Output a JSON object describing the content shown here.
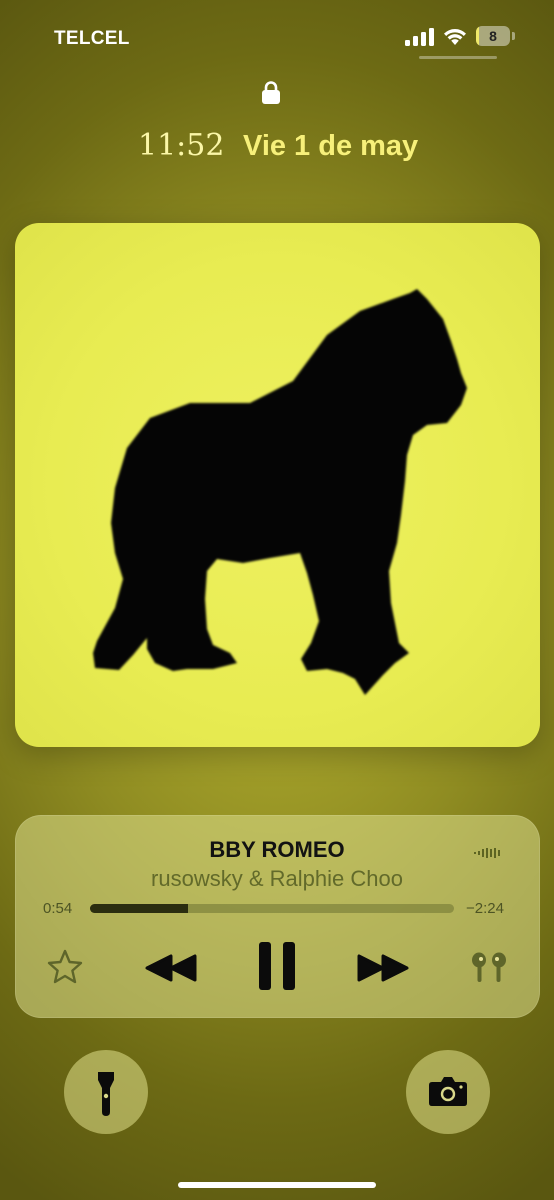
{
  "status_bar": {
    "carrier": "TELCEL",
    "battery_level": "8",
    "battery_fraction": 0.08,
    "icons": [
      "cellular-signal-icon",
      "wifi-icon",
      "battery-icon"
    ]
  },
  "lock_screen": {
    "lock_icon": "lock-icon",
    "time": "11:52",
    "date": "Vie 1 de may"
  },
  "now_playing": {
    "title": "BBY ROMEO",
    "artist": "rusowsky & Ralphie Choo",
    "elapsed": "0:54",
    "remaining": "−2:24",
    "progress_fraction": 0.27,
    "artwork": "gorilla-silhouette",
    "controls": [
      "favorite-star-icon",
      "rewind-icon",
      "pause-icon",
      "fast-forward-icon",
      "airpods-icon"
    ]
  },
  "quick_actions": [
    "flashlight-icon",
    "camera-icon"
  ],
  "colors": {
    "artwork_bg": "#e8ec52",
    "background": "#8f8c22",
    "date_text": "#f7f07a"
  }
}
